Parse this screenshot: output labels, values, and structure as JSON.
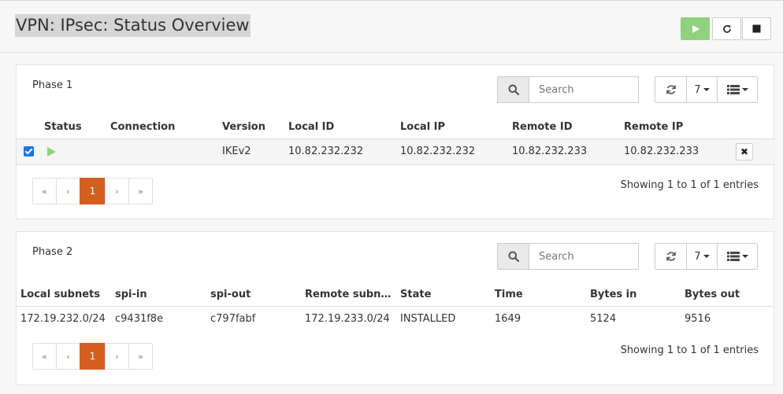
{
  "page": {
    "title": "VPN: IPsec: Status Overview",
    "header_buttons": [
      "start",
      "restart",
      "stop"
    ]
  },
  "colors": {
    "accent_start": "#8fd17d",
    "pager_active": "#d35f1e",
    "checkbox": "#1a73e8"
  },
  "phase1": {
    "title": "Phase 1",
    "search_placeholder": "Search",
    "page_size": "7",
    "columns": [
      "Status",
      "Connection",
      "Version",
      "Local ID",
      "Local IP",
      "Remote ID",
      "Remote IP"
    ],
    "rows": [
      {
        "selected": true,
        "status": "play-icon",
        "connection": "",
        "version": "IKEv2",
        "local_id": "10.82.232.232",
        "local_ip": "10.82.232.232",
        "remote_id": "10.82.232.233",
        "remote_ip": "10.82.232.233"
      }
    ],
    "pager": [
      "«",
      "‹",
      "1",
      "›",
      "»"
    ],
    "current_page": "1",
    "showing": "Showing 1 to 1 of 1 entries"
  },
  "phase2": {
    "title": "Phase 2",
    "search_placeholder": "Search",
    "page_size": "7",
    "columns": [
      "Local subnets",
      "spi-in",
      "spi-out",
      "Remote subn…",
      "State",
      "Time",
      "Bytes in",
      "Bytes out"
    ],
    "rows": [
      {
        "local_subnets": "172.19.232.0/24",
        "spi_in": "c9431f8e",
        "spi_out": "c797fabf",
        "remote_subnets": "172.19.233.0/24",
        "state": "INSTALLED",
        "time": "1649",
        "bytes_in": "5124",
        "bytes_out": "9516"
      }
    ],
    "pager": [
      "«",
      "‹",
      "1",
      "›",
      "»"
    ],
    "current_page": "1",
    "showing": "Showing 1 to 1 of 1 entries"
  }
}
